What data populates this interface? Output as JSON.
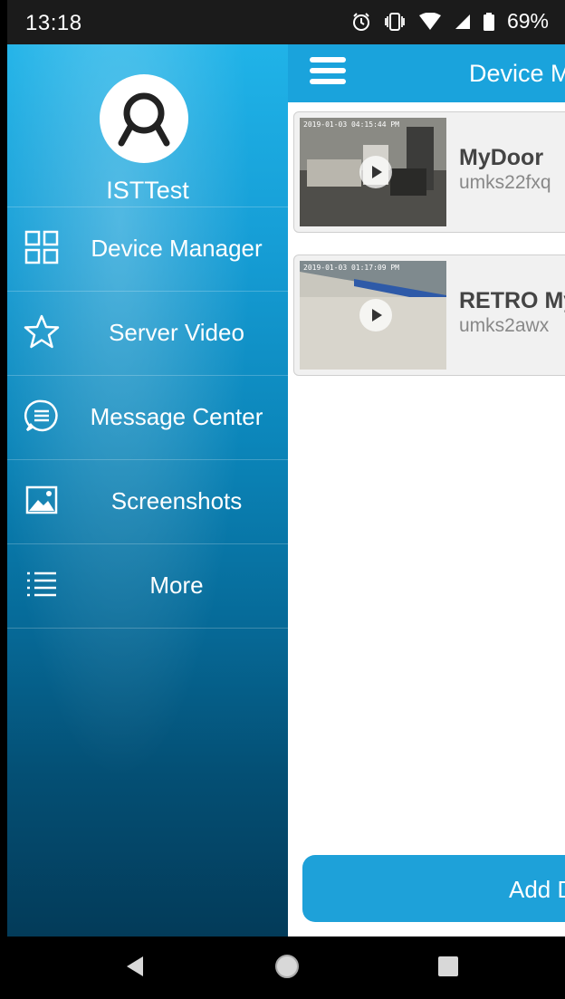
{
  "status_bar": {
    "time": "13:18",
    "battery": "69%"
  },
  "drawer": {
    "username": "ISTTest",
    "items": [
      {
        "label": "Device Manager",
        "icon": "grid-icon"
      },
      {
        "label": "Server Video",
        "icon": "star-icon"
      },
      {
        "label": "Message Center",
        "icon": "message-icon"
      },
      {
        "label": "Screenshots",
        "icon": "image-icon"
      },
      {
        "label": "More",
        "icon": "list-icon"
      }
    ]
  },
  "main": {
    "title": "Device Manager",
    "devices": [
      {
        "name": "MyDoor",
        "id": "umks22fxq",
        "timestamp": "2019-01-03 04:15:44 PM"
      },
      {
        "name": "RETRO My",
        "id": "umks2awx",
        "timestamp": "2019-01-03 01:17:09 PM"
      }
    ],
    "add_label": "Add Device"
  },
  "colors": {
    "accent": "#1aa3dc",
    "drawer_top": "#20b3e8",
    "drawer_bottom": "#033b59"
  }
}
